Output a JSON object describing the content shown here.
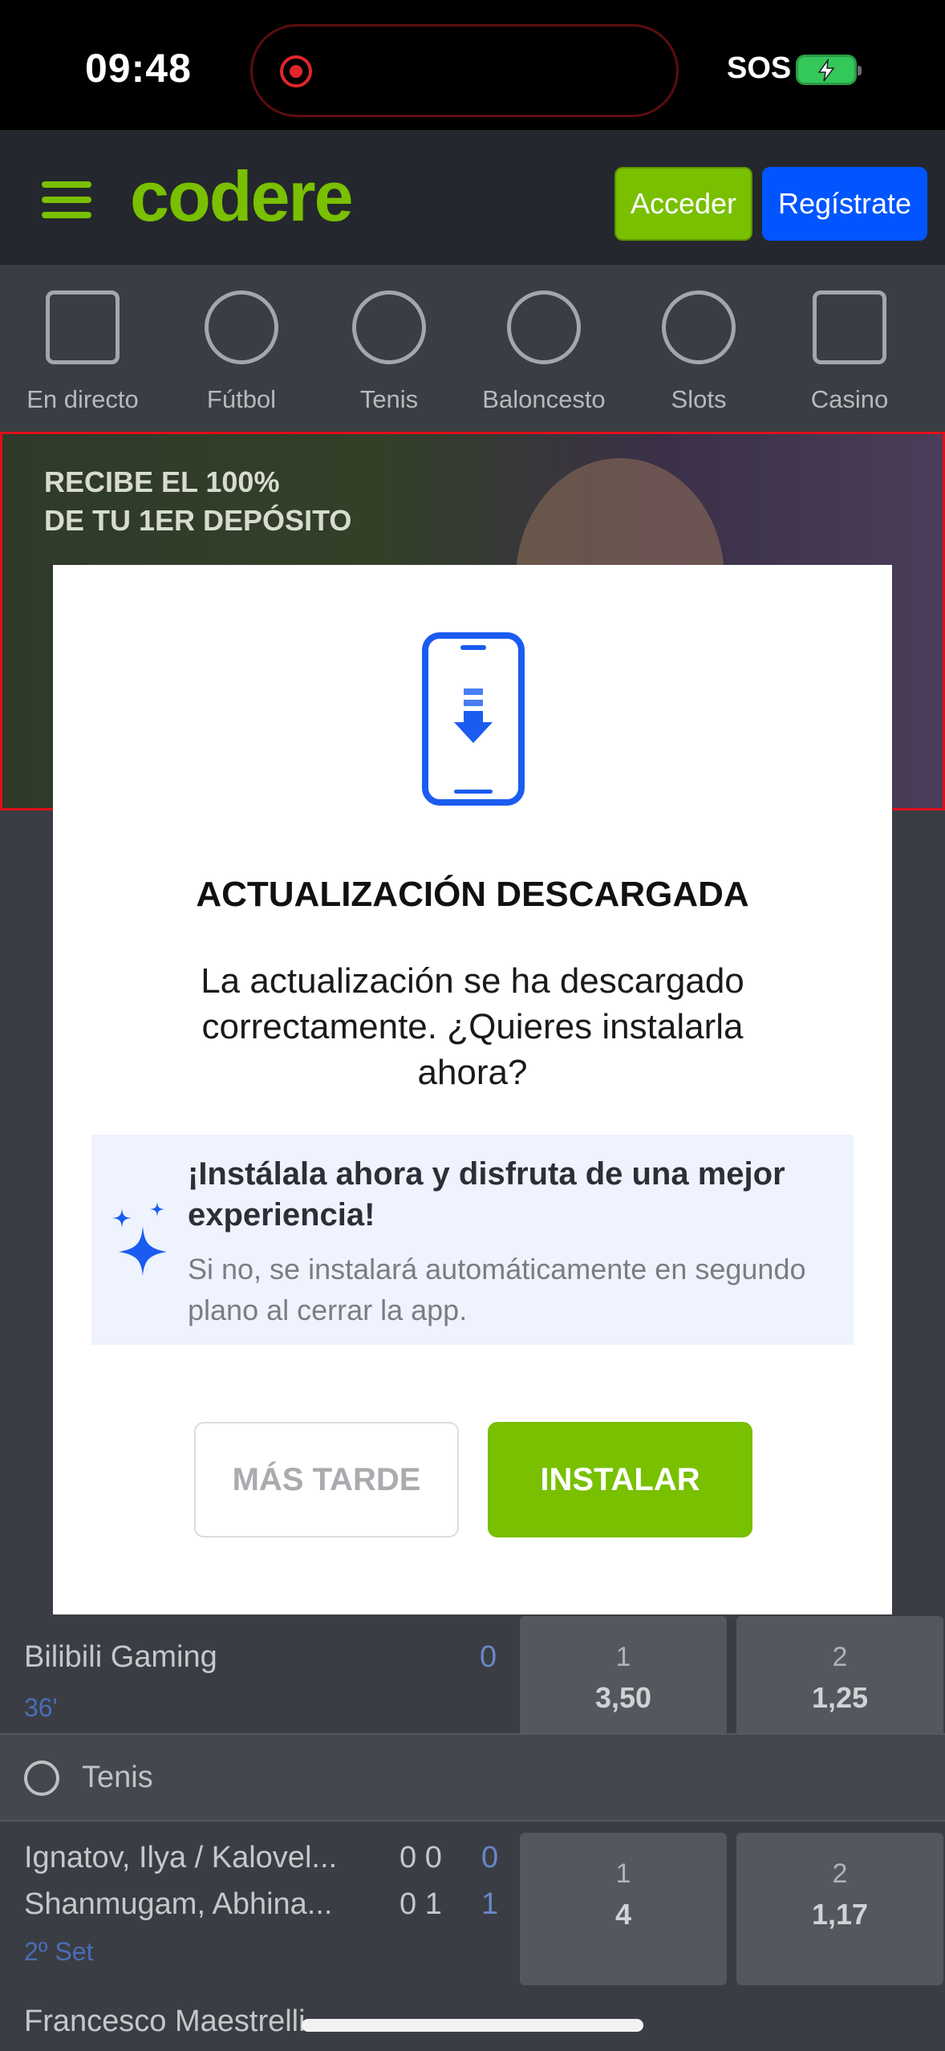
{
  "status_bar": {
    "time": "09:48",
    "sos": "SOS"
  },
  "header": {
    "logo": "codere",
    "login_label": "Acceder",
    "register_label": "Regístrate"
  },
  "sports_nav": [
    {
      "label": "En directo",
      "icon": "live-tv-icon"
    },
    {
      "label": "Fútbol",
      "icon": "soccer-ball-icon"
    },
    {
      "label": "Tenis",
      "icon": "tennis-ball-icon"
    },
    {
      "label": "Baloncesto",
      "icon": "basketball-icon"
    },
    {
      "label": "Slots",
      "icon": "cherries-icon"
    },
    {
      "label": "Casino",
      "icon": "cards-icon"
    }
  ],
  "banner": {
    "line1": "RECIBE EL 100%",
    "line2": "DE TU 1ER DEPÓSITO"
  },
  "background": {
    "tenis_header": "Tenis",
    "esports_team": "Bilibili Gaming",
    "esports_score": "0",
    "esports_time": "36'",
    "esports_odds": [
      {
        "label": "1",
        "value": "3,50"
      },
      {
        "label": "2",
        "value": "1,25"
      }
    ],
    "tennis_team1": "Ignatov, Ilya / Kalovel...",
    "tennis_team2": "Shanmugam, Abhina...",
    "tennis_score1": "0 0",
    "tennis_score2": "0 1",
    "tennis_points1": "0",
    "tennis_points2": "1",
    "tennis_set": "2º Set",
    "tennis_odds": [
      {
        "label": "1",
        "value": "4"
      },
      {
        "label": "2",
        "value": "1,17"
      }
    ],
    "next_match": "Francesco Maestrelli"
  },
  "modal": {
    "title": "ACTUALIZACIÓN DESCARGADA",
    "description": "La actualización se ha descargado correctamente. ¿Quieres instalarla ahora?",
    "info_title": "¡Instálala ahora y disfruta de una mejor experiencia!",
    "info_subtitle": "Si no, se instalará automáticamente en segundo plano al cerrar la app.",
    "later_label": "MÁS TARDE",
    "install_label": "INSTALAR"
  },
  "colors": {
    "brand_green": "#79c000",
    "brand_blue": "#0055ff",
    "icon_blue": "#1a5cf0"
  }
}
